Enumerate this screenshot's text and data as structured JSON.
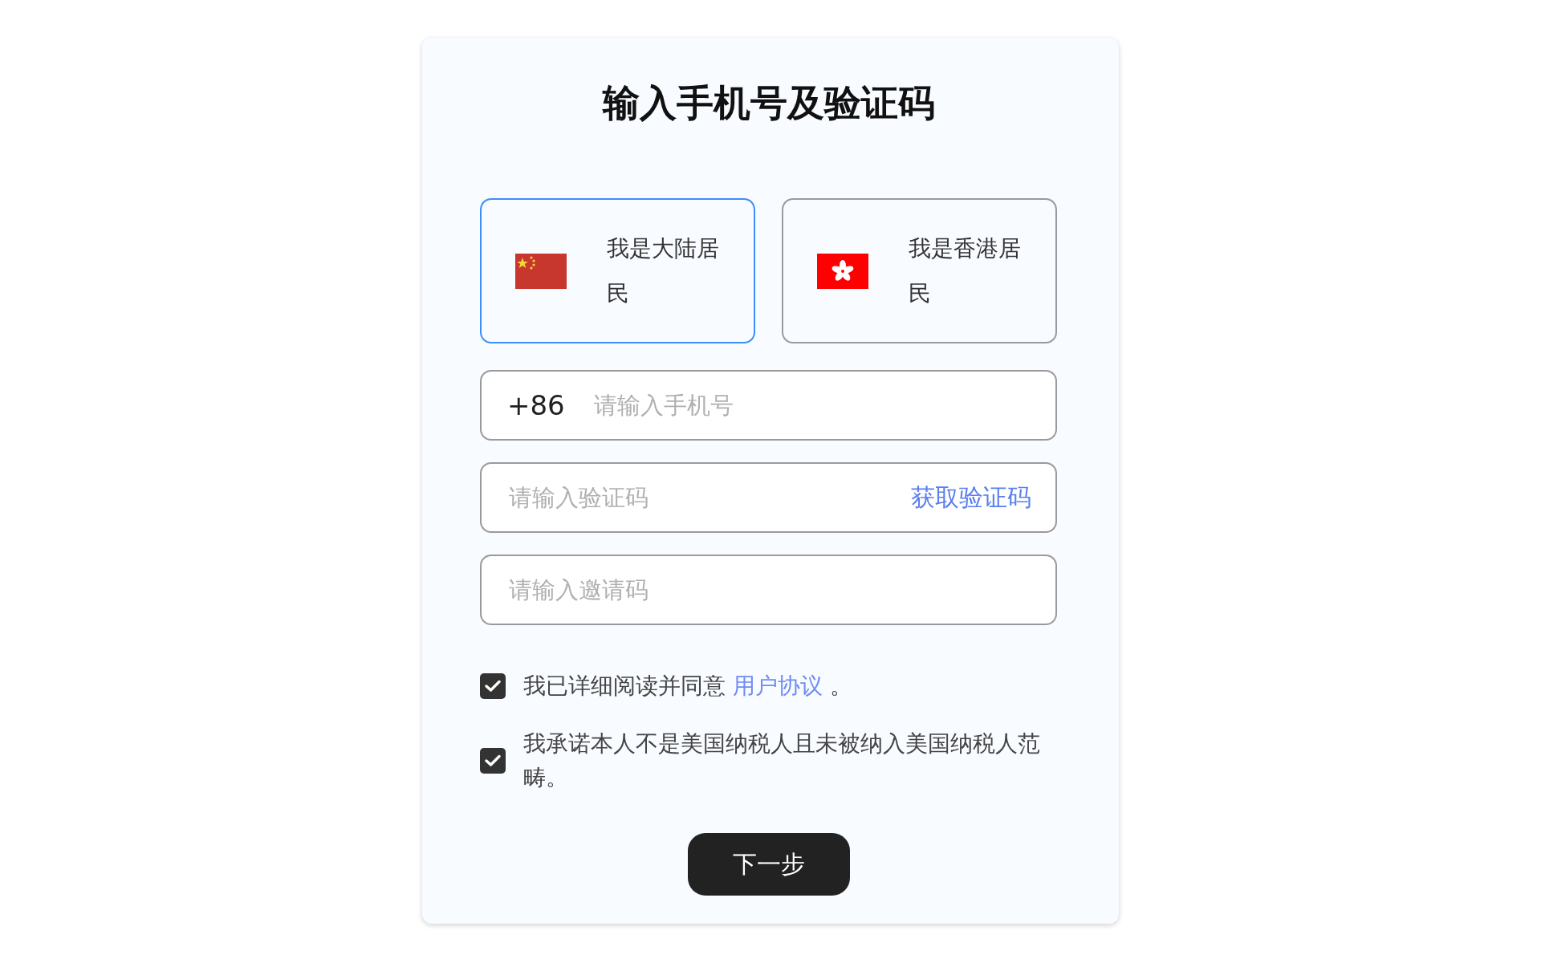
{
  "title": "输入手机号及验证码",
  "regions": [
    {
      "kind": "cn",
      "label": "我是大陆居民",
      "selected": true
    },
    {
      "kind": "hk",
      "label": "我是香港居民",
      "selected": false
    }
  ],
  "fields": [
    {
      "kind": "phone",
      "prefix": "+86",
      "placeholder": "请输入手机号"
    },
    {
      "kind": "code",
      "placeholder": "请输入验证码",
      "action": "获取验证码"
    },
    {
      "kind": "plain",
      "placeholder": "请输入邀请码"
    }
  ],
  "agreements": [
    {
      "text": "我已详细阅读并同意 ",
      "link": "用户协议",
      "suffix": " 。",
      "checked": true
    },
    {
      "text": "我承诺本人不是美国纳税人且未被纳入美国纳税人范畴。",
      "checked": true
    }
  ],
  "next_button": "下一步"
}
